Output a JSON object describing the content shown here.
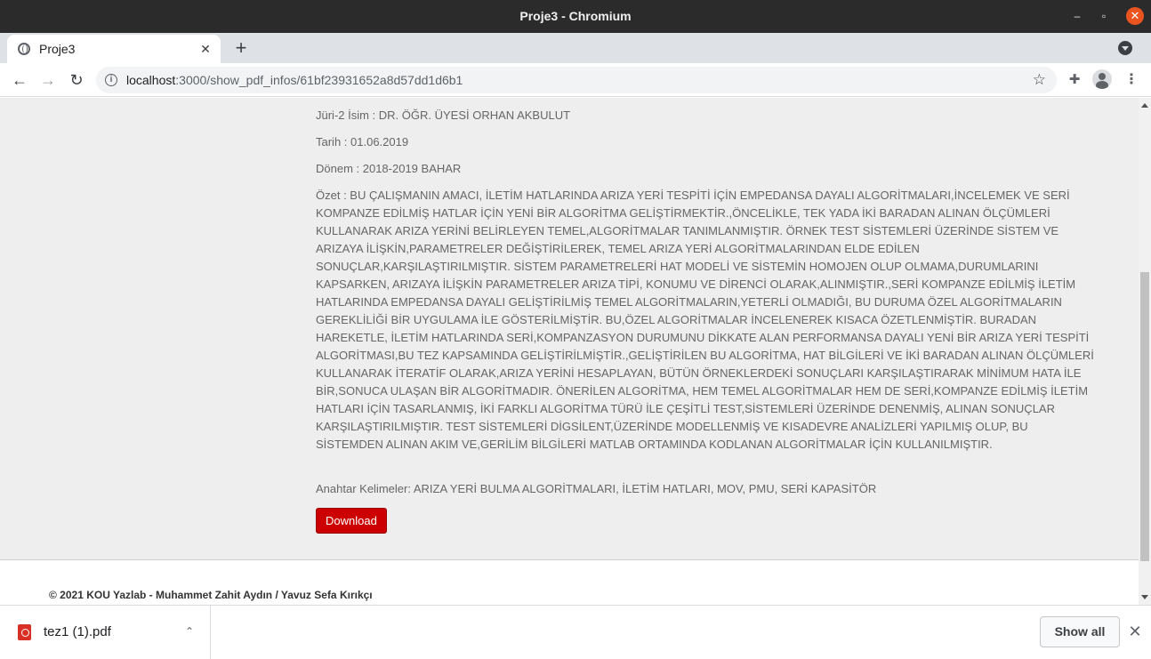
{
  "window": {
    "title": "Proje3 - Chromium",
    "minimize_glyph": "–",
    "maximize_glyph": "▫",
    "close_glyph": "✕"
  },
  "tab": {
    "title": "Proje3",
    "close_glyph": "✕",
    "new_tab_glyph": "+"
  },
  "toolbar": {
    "back_glyph": "←",
    "forward_glyph": "→",
    "reload_glyph": "↻",
    "url_host": "localhost",
    "url_rest": ":3000/show_pdf_infos/61bf23931652a8d57dd1d6b1",
    "star_glyph": "☆",
    "extensions_glyph": "✚",
    "menu_glyph": "⋮"
  },
  "details": {
    "juri2": "Jüri-2 İsim : DR. ÖĞR. ÜYESİ ORHAN AKBULUT",
    "tarih": "Tarih : 01.06.2019",
    "donem": "Dönem : 2018-2019 BAHAR",
    "ozet": "Özet : BU ÇALIŞMANIN AMACI, İLETİM HATLARINDA ARIZA YERİ TESPİTİ İÇİN EMPEDANSA DAYALI ALGORİTMALARI,İNCELEMEK VE SERİ KOMPANZE EDİLMİŞ HATLAR İÇİN YENİ BİR ALGORİTMA GELİŞTİRMEKTİR.,ÖNCELİKLE, TEK YADA İKİ BARADAN ALINAN ÖLÇÜMLERİ KULLANARAK ARIZA YERİNİ BELİRLEYEN TEMEL,ALGORİTMALAR TANIMLANMIŞTIR. ÖRNEK TEST SİSTEMLERİ ÜZERİNDE SİSTEM VE ARIZAYA İLİŞKİN,PARAMETRELER DEĞİŞTİRİLEREK, TEMEL ARIZA YERİ ALGORİTMALARINDAN ELDE EDİLEN SONUÇLAR,KARŞILAŞTIRILMIŞTIR. SİSTEM PARAMETRELERİ HAT MODELİ VE SİSTEMİN HOMOJEN OLUP OLMAMA,DURUMLARINI KAPSARKEN, ARIZAYA İLİŞKİN PARAMETRELER ARIZA TİPİ, KONUMU VE DİRENCİ OLARAK,ALINMIŞTIR.,SERİ KOMPANZE EDİLMİŞ İLETİM HATLARINDA EMPEDANSA DAYALI GELİŞTİRİLMİŞ TEMEL ALGORİTMALARIN,YETERLİ OLMADIĞI, BU DURUMA ÖZEL ALGORİTMALARIN GEREKLİLİĞİ BİR UYGULAMA İLE GÖSTERİLMİŞTİR. BU,ÖZEL ALGORİTMALAR İNCELENEREK KISACA ÖZETLENMİŞTİR. BURADAN HAREKETLE, İLETİM HATLARINDA SERİ,KOMPANZASYON DURUMUNU DİKKATE ALAN PERFORMANSA DAYALI YENİ BİR ARIZA YERİ TESPİTİ ALGORİTMASI,BU TEZ KAPSAMINDA GELİŞTİRİLMİŞTİR.,GELİŞTİRİLEN BU ALGORİTMA, HAT BİLGİLERİ VE İKİ BARADAN ALINAN ÖLÇÜMLERİ KULLANARAK İTERATİF OLARAK,ARIZA YERİNİ HESAPLAYAN, BÜTÜN ÖRNEKLERDEKİ SONUÇLARI KARŞILAŞTIRARAK MİNİMUM HATA İLE BİR,SONUCA ULAŞAN BİR ALGORİTMADIR. ÖNERİLEN ALGORİTMA, HEM TEMEL ALGORİTMALAR HEM DE SERİ,KOMPANZE EDİLMİŞ İLETİM HATLARI İÇİN TASARLANMIŞ, İKİ FARKLI ALGORİTMA TÜRÜ İLE ÇEŞİTLİ TEST,SİSTEMLERİ ÜZERİNDE DENENMİŞ, ALINAN SONUÇLAR KARŞILAŞTIRILMIŞTIR. TEST SİSTEMLERİ DİGSİLENT,ÜZERİNDE MODELLENMİŞ VE KISADEVRE ANALİZLERİ YAPILMIŞ OLUP, BU SİSTEMDEN ALINAN AKIM VE,GERİLİM BİLGİLERİ MATLAB ORTAMINDA KODLANAN ALGORİTMALAR İÇİN KULLANILMIŞTIR.",
    "anahtar": "Anahtar Kelimeler: ARIZA YERİ BULMA ALGORİTMALARI, İLETİM HATLARI, MOV, PMU, SERİ KAPASİTÖR",
    "download_label": "Download"
  },
  "footer": {
    "text": "© 2021 KOU Yazlab - Muhammet Zahit Aydın / Yavuz Sefa Kırıkçı"
  },
  "download_shelf": {
    "file_name": "tez1 (1).pdf",
    "chevron_glyph": "⌃",
    "show_all_label": "Show all",
    "close_glyph": "✕"
  },
  "colors": {
    "download_button": "#cc0000",
    "titlebar": "#2b2b2b",
    "close_window": "#e95420",
    "page_background": "#eeeeee"
  }
}
